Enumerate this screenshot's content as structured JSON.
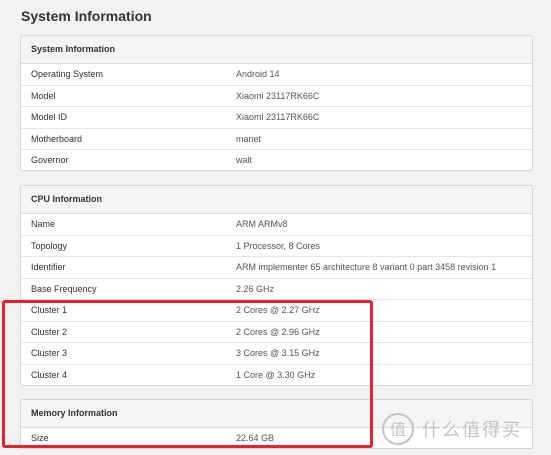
{
  "page": {
    "title": "System Information"
  },
  "system": {
    "header": "System Information",
    "rows": [
      {
        "key": "Operating System",
        "value": "Android 14"
      },
      {
        "key": "Model",
        "value": "Xiaomi 23117RK66C"
      },
      {
        "key": "Model ID",
        "value": "Xiaomi 23117RK66C"
      },
      {
        "key": "Motherboard",
        "value": "manet"
      },
      {
        "key": "Governor",
        "value": "walt"
      }
    ]
  },
  "cpu": {
    "header": "CPU Information",
    "rows": [
      {
        "key": "Name",
        "value": "ARM ARMv8"
      },
      {
        "key": "Topology",
        "value": "1 Processor, 8 Cores"
      },
      {
        "key": "Identifier",
        "value": "ARM implementer 65 architecture 8 variant 0 part 3458 revision 1"
      },
      {
        "key": "Base Frequency",
        "value": "2.26 GHz"
      },
      {
        "key": "Cluster 1",
        "value": "2 Cores @ 2.27 GHz"
      },
      {
        "key": "Cluster 2",
        "value": "2 Cores @ 2.96 GHz"
      },
      {
        "key": "Cluster 3",
        "value": "3 Cores @ 3.15 GHz"
      },
      {
        "key": "Cluster 4",
        "value": "1 Core @ 3.30 GHz"
      }
    ]
  },
  "memory": {
    "header": "Memory Information",
    "rows": [
      {
        "key": "Size",
        "value": "22.64 GB"
      }
    ]
  },
  "watermark": {
    "text": "什么值得买",
    "logo_char": "值"
  },
  "colors": {
    "highlight": "#e8222a",
    "watermark": "#c4c4c4"
  }
}
